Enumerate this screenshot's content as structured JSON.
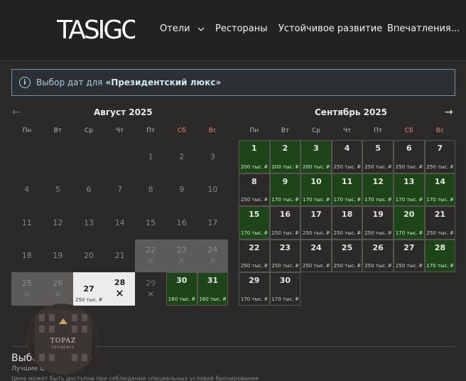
{
  "brand": {
    "logo_text": "TASIGO"
  },
  "nav": {
    "items": [
      {
        "label": "Отели",
        "has_dropdown": true
      },
      {
        "label": "Рестораны"
      },
      {
        "label": "Устойчивое развитие"
      },
      {
        "label": "Впечатления..."
      }
    ]
  },
  "notice": {
    "text": "Выбор дат для",
    "room": "«Президентский люкс»"
  },
  "calendar": {
    "months": [
      {
        "title": "Август 2025"
      },
      {
        "title": "Сентябрь 2025"
      }
    ],
    "weekdays": [
      "Пн",
      "Вт",
      "Ср",
      "Чт",
      "Пт",
      "Сб",
      "Вс"
    ],
    "august": [
      {
        "day": ""
      },
      {
        "day": ""
      },
      {
        "day": ""
      },
      {
        "day": ""
      },
      {
        "day": "1"
      },
      {
        "day": "2"
      },
      {
        "day": "3"
      },
      {
        "day": "4"
      },
      {
        "day": "5"
      },
      {
        "day": "6"
      },
      {
        "day": "7"
      },
      {
        "day": "8"
      },
      {
        "day": "9"
      },
      {
        "day": "10"
      },
      {
        "day": "11"
      },
      {
        "day": "12"
      },
      {
        "day": "13"
      },
      {
        "day": "14"
      },
      {
        "day": "15"
      },
      {
        "day": "16"
      },
      {
        "day": "17"
      },
      {
        "day": "18"
      },
      {
        "day": "19"
      },
      {
        "day": "20"
      },
      {
        "day": "21"
      },
      {
        "day": "22",
        "state": "blocked"
      },
      {
        "day": "23",
        "state": "blocked"
      },
      {
        "day": "24",
        "state": "blocked"
      },
      {
        "day": "25",
        "state": "blocked"
      },
      {
        "day": "26",
        "state": "blocked"
      },
      {
        "day": "27",
        "state": "white",
        "price": "250 тыс. ₽"
      },
      {
        "day": "28",
        "state": "white-x"
      },
      {
        "day": "29",
        "state": "gone"
      },
      {
        "day": "30",
        "state": "green",
        "price": "160 тыс. ₽"
      },
      {
        "day": "31",
        "state": "green",
        "price": "160 тыс. ₽"
      }
    ],
    "september": [
      {
        "day": "1",
        "state": "green",
        "price": "200 тыс. ₽"
      },
      {
        "day": "2",
        "state": "green",
        "price": "200 тыс. ₽"
      },
      {
        "day": "3",
        "state": "green",
        "price": "200 тыс. ₽"
      },
      {
        "day": "4",
        "state": "avail",
        "price": "250 тыс. ₽"
      },
      {
        "day": "5",
        "state": "avail",
        "price": "250 тыс. ₽"
      },
      {
        "day": "6",
        "state": "avail",
        "price": "250 тыс. ₽"
      },
      {
        "day": "7",
        "state": "avail",
        "price": "250 тыс. ₽"
      },
      {
        "day": "8",
        "state": "avail",
        "price": "250 тыс. ₽"
      },
      {
        "day": "9",
        "state": "green",
        "price": "170 тыс. ₽"
      },
      {
        "day": "10",
        "state": "green",
        "price": "170 тыс. ₽"
      },
      {
        "day": "11",
        "state": "green",
        "price": "170 тыс. ₽"
      },
      {
        "day": "12",
        "state": "green",
        "price": "170 тыс. ₽"
      },
      {
        "day": "13",
        "state": "green",
        "price": "170 тыс. ₽"
      },
      {
        "day": "14",
        "state": "green",
        "price": "170 тыс. ₽"
      },
      {
        "day": "15",
        "state": "green",
        "price": "170 тыс. ₽"
      },
      {
        "day": "16",
        "state": "avail",
        "price": "250 тыс. ₽"
      },
      {
        "day": "17",
        "state": "avail",
        "price": "250 тыс. ₽"
      },
      {
        "day": "18",
        "state": "avail",
        "price": "250 тыс. ₽"
      },
      {
        "day": "19",
        "state": "avail",
        "price": "250 тыс. ₽"
      },
      {
        "day": "20",
        "state": "green",
        "price": "170 тыс. ₽"
      },
      {
        "day": "21",
        "state": "avail",
        "price": "250 тыс. ₽"
      },
      {
        "day": "22",
        "state": "avail",
        "price": "250 тыс. ₽"
      },
      {
        "day": "23",
        "state": "avail",
        "price": "250 тыс. ₽"
      },
      {
        "day": "24",
        "state": "avail",
        "price": "250 тыс. ₽"
      },
      {
        "day": "25",
        "state": "avail",
        "price": "250 тыс. ₽"
      },
      {
        "day": "26",
        "state": "avail",
        "price": "250 тыс. ₽"
      },
      {
        "day": "27",
        "state": "avail",
        "price": "250 тыс. ₽"
      },
      {
        "day": "28",
        "state": "green",
        "price": "170 тыс. ₽"
      },
      {
        "day": "29",
        "state": "avail",
        "price": "170 тыс. ₽"
      },
      {
        "day": "30",
        "state": "avail",
        "price": "170 тыс. ₽"
      }
    ]
  },
  "bottom": {
    "title": "Выбе                  зда",
    "subtitle": "Лучшие це                  я за ночь",
    "note": "Цена может быть доступна при соблюдении специальных условий бронирования"
  },
  "hotel_badge": {
    "brand": "TOPAZ",
    "subtitle": "RESIDENCE"
  },
  "colors": {
    "green": "#1d4519",
    "blocked": "#5c5b5a",
    "accent": "#a9cde3",
    "weekend": "#e58a7a"
  }
}
